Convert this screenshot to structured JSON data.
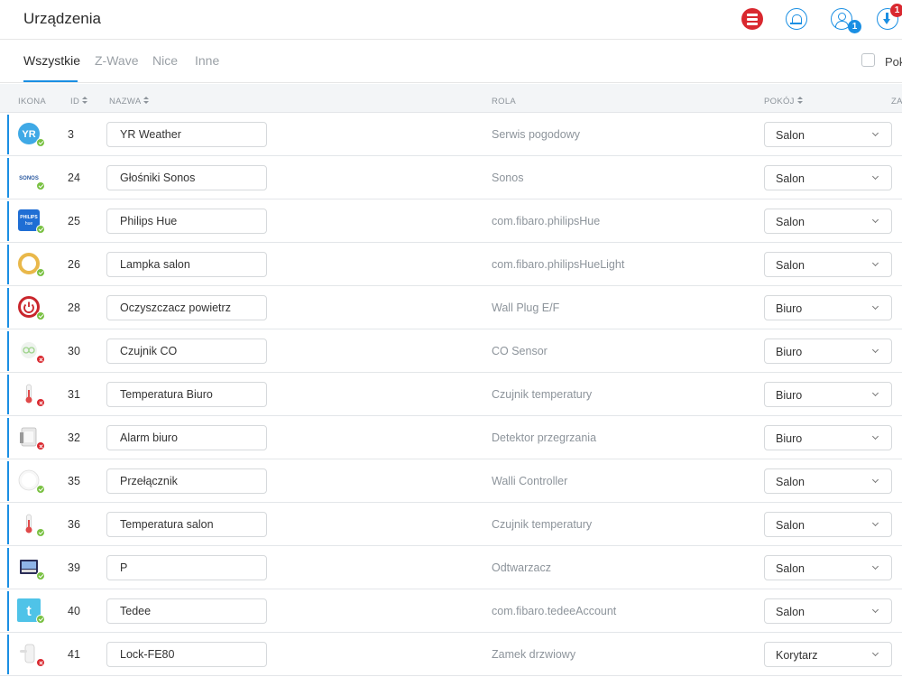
{
  "header": {
    "title": "Urządzenia",
    "users_badge": "1",
    "download_badge": "1"
  },
  "tabs": [
    {
      "label": "Wszystkie",
      "active": true
    },
    {
      "label": "Z-Wave",
      "active": false
    },
    {
      "label": "Nice",
      "active": false
    },
    {
      "label": "Inne",
      "active": false
    }
  ],
  "filter_checkbox_label": "Pok",
  "columns": {
    "icon": "IKONA",
    "id": "ID",
    "name": "NAZWA",
    "role": "ROLA",
    "room": "POKÓJ",
    "extra": "ZA"
  },
  "accent_color": "#1a8fe3",
  "devices": [
    {
      "icon": "yr-weather-icon",
      "status": "ok",
      "id": "3",
      "name": "YR Weather",
      "role": "Serwis pogodowy",
      "room": "Salon"
    },
    {
      "icon": "sonos-icon",
      "icon_text": "SONOS",
      "status": "ok",
      "id": "24",
      "name": "Głośniki Sonos",
      "role": "Sonos",
      "room": "Salon"
    },
    {
      "icon": "philips-hue-icon",
      "icon_text": "PHILIPS",
      "icon_text2": "hue",
      "status": "ok",
      "id": "25",
      "name": "Philips Hue",
      "role": "com.fibaro.philipsHue",
      "room": "Salon"
    },
    {
      "icon": "lamp-ring-icon",
      "status": "ok",
      "id": "26",
      "name": "Lampka salon",
      "role": "com.fibaro.philipsHueLight",
      "room": "Salon"
    },
    {
      "icon": "wall-plug-icon",
      "status": "ok",
      "id": "28",
      "name": "Oczyszczacz powietrz",
      "role": "Wall Plug E/F",
      "room": "Biuro"
    },
    {
      "icon": "co-sensor-icon",
      "status": "err",
      "id": "30",
      "name": "Czujnik CO",
      "role": "CO Sensor",
      "room": "Biuro"
    },
    {
      "icon": "thermometer-icon",
      "status": "err",
      "id": "31",
      "name": "Temperatura Biuro",
      "role": "Czujnik temperatury",
      "room": "Biuro"
    },
    {
      "icon": "heat-detector-icon",
      "status": "err",
      "id": "32",
      "name": "Alarm biuro",
      "role": "Detektor przegrzania",
      "room": "Biuro"
    },
    {
      "icon": "walli-switch-icon",
      "status": "ok",
      "id": "35",
      "name": "Przełącznik",
      "role": "Walli Controller",
      "room": "Salon"
    },
    {
      "icon": "thermometer-icon",
      "status": "ok",
      "id": "36",
      "name": "Temperatura salon",
      "role": "Czujnik temperatury",
      "room": "Salon"
    },
    {
      "icon": "media-player-icon",
      "status": "ok",
      "id": "39",
      "name": "P",
      "role": "Odtwarzacz",
      "room": "Salon"
    },
    {
      "icon": "tedee-icon",
      "icon_text": "t",
      "status": "ok",
      "id": "40",
      "name": "Tedee",
      "role": "com.fibaro.tedeeAccount",
      "room": "Salon"
    },
    {
      "icon": "door-lock-icon",
      "status": "err",
      "id": "41",
      "name": "Lock-FE80",
      "role": "Zamek drzwiowy",
      "room": "Korytarz"
    }
  ]
}
